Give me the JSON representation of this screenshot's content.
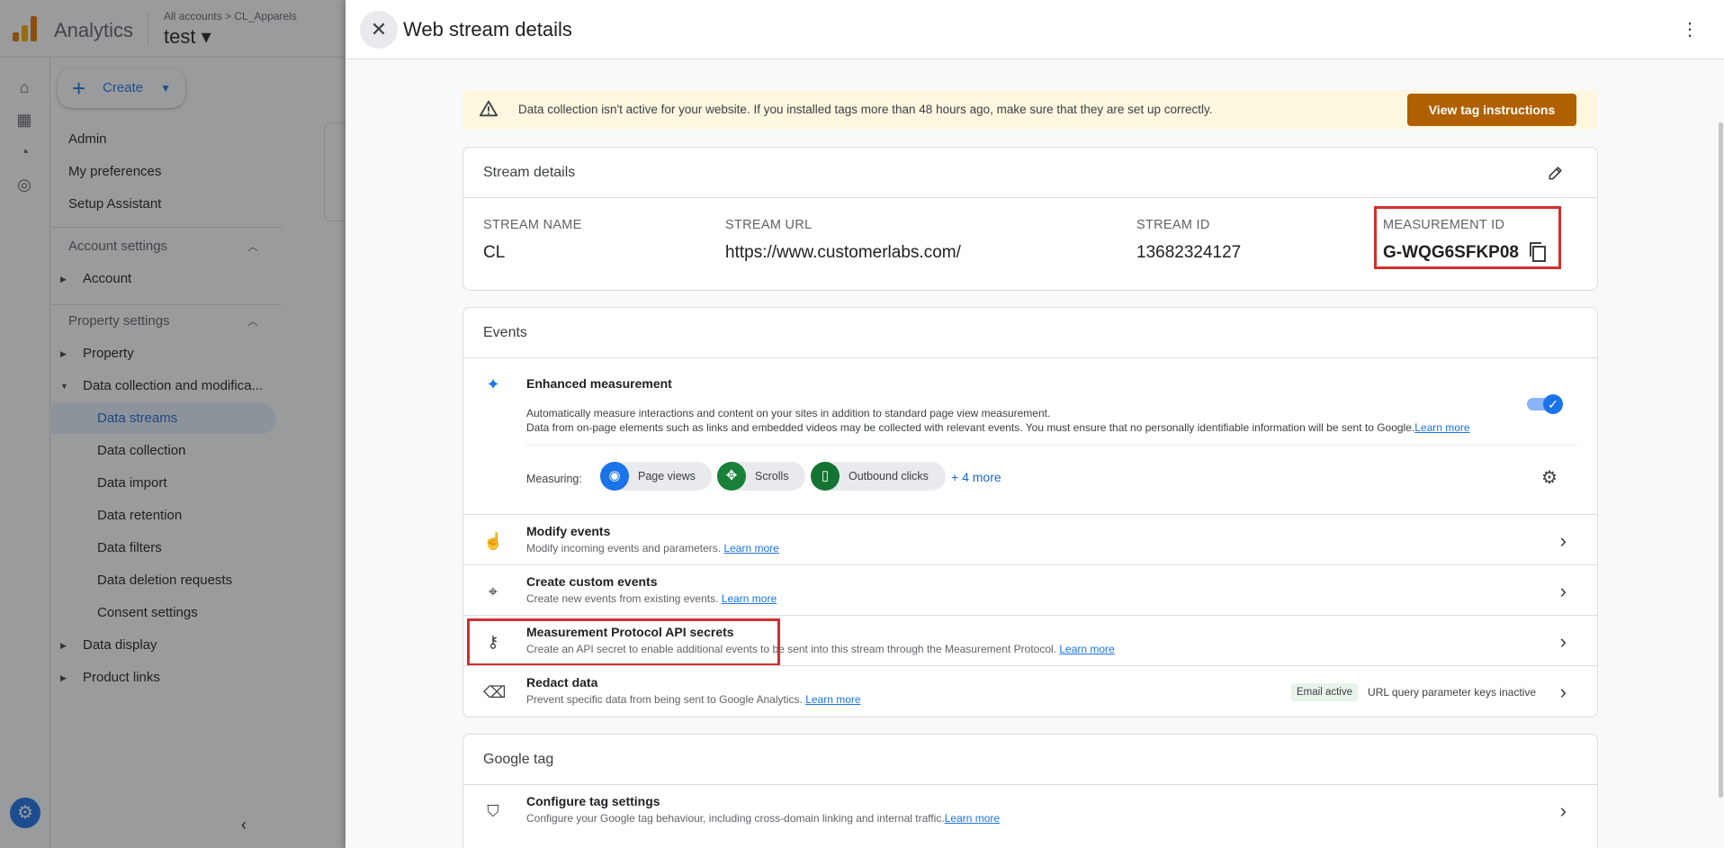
{
  "app": {
    "name": "Analytics",
    "breadcrumb": "All accounts > CL_Apparels",
    "property": "test ▾",
    "create_label": "Create"
  },
  "sidebar": {
    "items": [
      {
        "label": "Admin"
      },
      {
        "label": "My preferences"
      },
      {
        "label": "Setup Assistant"
      }
    ],
    "account_section": "Account settings",
    "account_items": [
      {
        "label": "Account"
      }
    ],
    "property_section": "Property settings",
    "property_items": [
      {
        "label": "Property"
      },
      {
        "label": "Data collection and modifica..."
      }
    ],
    "sub_items": [
      {
        "label": "Data streams"
      },
      {
        "label": "Data collection"
      },
      {
        "label": "Data import"
      },
      {
        "label": "Data retention"
      },
      {
        "label": "Data filters"
      },
      {
        "label": "Data deletion requests"
      },
      {
        "label": "Consent settings"
      }
    ],
    "bottom_items": [
      {
        "label": "Data display"
      },
      {
        "label": "Product links"
      }
    ]
  },
  "panel": {
    "title": "Web stream details"
  },
  "alert": {
    "text": "Data collection isn't active for your website. If you installed tags more than 48 hours ago, make sure that they are set up correctly.",
    "button": "View tag instructions"
  },
  "stream_details": {
    "title": "Stream details",
    "name_label": "STREAM NAME",
    "name_value": "CL",
    "url_label": "STREAM URL",
    "url_value": "https://www.customerlabs.com/",
    "id_label": "STREAM ID",
    "id_value": "13682324127",
    "mid_label": "MEASUREMENT ID",
    "mid_value": "G-WQG6SFKP08"
  },
  "events": {
    "title": "Events",
    "enhanced": {
      "title": "Enhanced measurement",
      "desc1": "Automatically measure interactions and content on your sites in addition to standard page view measurement.",
      "desc2": "Data from on-page elements such as links and embedded videos may be collected with relevant events. You must ensure that no personally identifiable information will be sent to Google.",
      "learn_more": "Learn more",
      "measuring_label": "Measuring:",
      "chips": [
        {
          "label": "Page views"
        },
        {
          "label": "Scrolls"
        },
        {
          "label": "Outbound clicks"
        }
      ],
      "more": "+ 4 more"
    },
    "rows": [
      {
        "title": "Modify events",
        "desc": "Modify incoming events and parameters.",
        "link": "Learn more"
      },
      {
        "title": "Create custom events",
        "desc": "Create new events from existing events.",
        "link": "Learn more"
      },
      {
        "title": "Measurement Protocol API secrets",
        "desc": "Create an API secret to enable additional events to be sent into this stream through the Measurement Protocol.",
        "link": "Learn more"
      },
      {
        "title": "Redact data",
        "desc": "Prevent specific data from being sent to Google Analytics.",
        "link": "Learn more",
        "badge": "Email active",
        "status": "URL query parameter keys inactive"
      }
    ]
  },
  "google_tag": {
    "title": "Google tag",
    "row": {
      "title": "Configure tag settings",
      "desc": "Configure your Google tag behaviour, including cross-domain linking and internal traffic.",
      "link": "Learn more"
    }
  },
  "colors": {
    "accent": "#1a73e8",
    "warning_button": "#b06000",
    "highlight": "#d32f2f"
  }
}
